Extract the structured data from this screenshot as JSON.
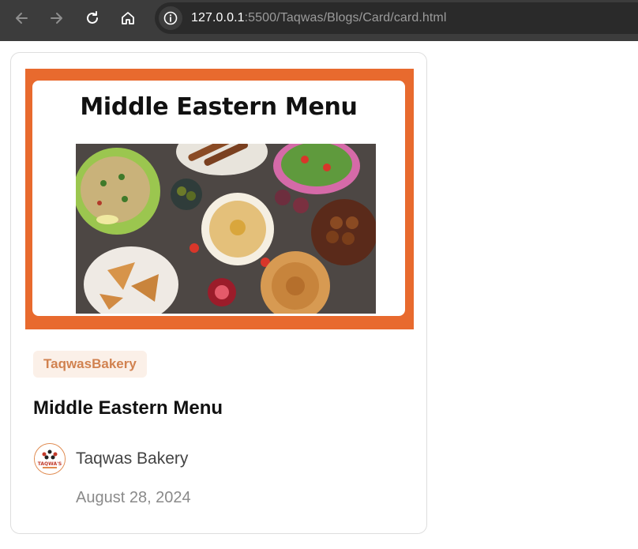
{
  "browser": {
    "url_host": "127.0.0.1",
    "url_rest": ":5500/Taqwas/Blogs/Card/card.html",
    "icons": [
      "back-arrow-icon",
      "forward-arrow-icon",
      "reload-icon",
      "home-icon",
      "info-icon"
    ]
  },
  "card": {
    "image_title": "Middle Eastern Menu",
    "tag": "TaqwasBakery",
    "title": "Middle Eastern Menu",
    "author": "Taqwas Bakery",
    "date": "August 28, 2024",
    "accent_color": "#e86a2e",
    "tag_text_color": "#d18250",
    "tag_bg_color": "#fbf0e8",
    "avatar_text": "TAQWA'S"
  }
}
